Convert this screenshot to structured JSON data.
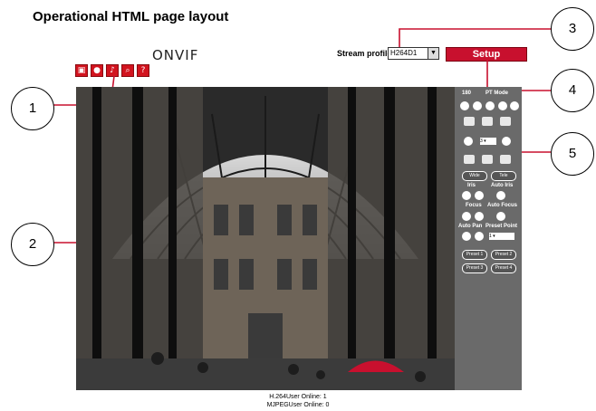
{
  "page": {
    "title": "Operational HTML page layout"
  },
  "header": {
    "logo": "ONVIF",
    "stream_profile_label": "Stream profile",
    "stream_profile_value": "H264D1",
    "setup_label": "Setup"
  },
  "toolbar": {
    "icons": [
      "snapshot-icon",
      "record-icon",
      "audio-icon",
      "zoom-icon",
      "help-icon"
    ],
    "help_glyph": "?"
  },
  "callouts": [
    "1",
    "2",
    "3",
    "4",
    "5"
  ],
  "ptz": {
    "labels": {
      "deg": "180",
      "pt_mode": "PT Mode",
      "wide": "Wide",
      "tele": "Tele",
      "iris": "Iris",
      "auto_iris": "Auto Iris",
      "focus": "Focus",
      "auto_focus": "Auto Focus",
      "auto_pan": "Auto Pan",
      "preset_point": "Preset Point"
    },
    "speed_value": "3",
    "preset_point_value": "1",
    "presets": [
      "Preset 1",
      "Preset 2",
      "Preset 3",
      "Preset 4"
    ]
  },
  "status": {
    "h264": "H.264User Online: 1",
    "mjpeg": "MJPEGUser Online: 0"
  },
  "colors": {
    "accent": "#c8102e",
    "panel": "#6a6a6a"
  }
}
